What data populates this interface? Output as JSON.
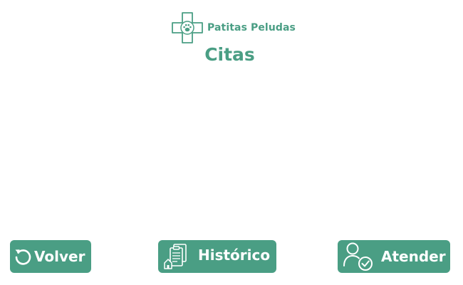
{
  "brand": {
    "name": "Patitas Peludas",
    "icon": "paw-cross-logo-icon",
    "color": "#4a9e84"
  },
  "page": {
    "title": "Citas"
  },
  "actions": {
    "back_label": "Volver",
    "back_icon": "refresh-icon",
    "history_label": "Histórico",
    "history_icon": "clipboard-history-icon",
    "attend_label": "Atender",
    "attend_icon": "user-check-icon"
  },
  "colors": {
    "accent": "#4a9e84",
    "button_text": "#ffffff",
    "background": "#ffffff"
  }
}
